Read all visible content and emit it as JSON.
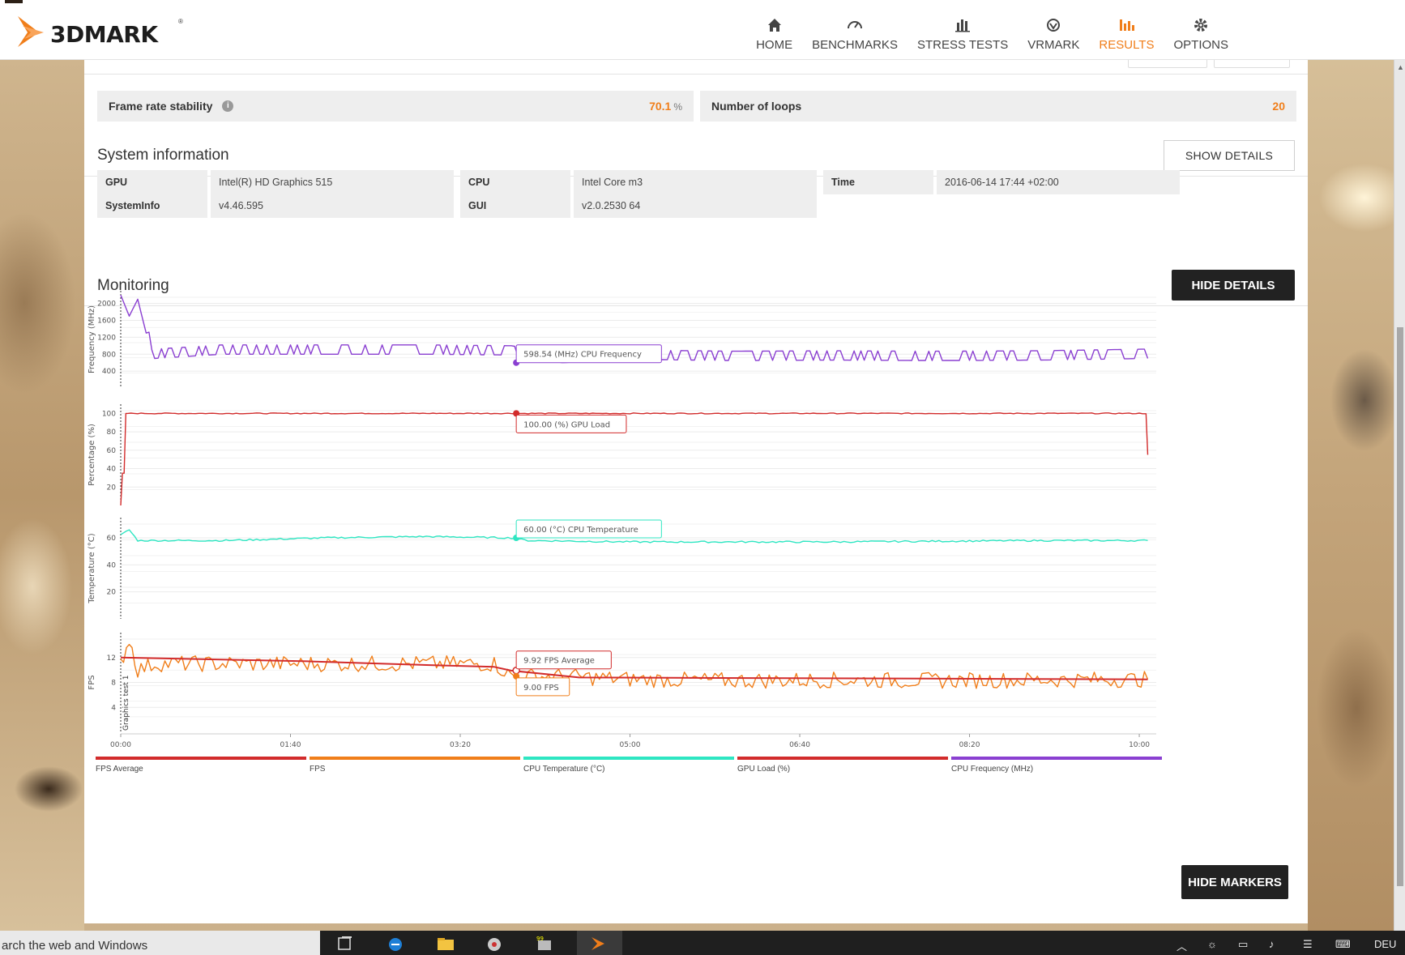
{
  "app": {
    "logo_text": "3DMARK"
  },
  "nav": {
    "items": [
      {
        "label": "HOME",
        "icon": "home-icon",
        "active": false
      },
      {
        "label": "BENCHMARKS",
        "icon": "gauge-icon",
        "active": false
      },
      {
        "label": "STRESS TESTS",
        "icon": "bars-icon",
        "active": false
      },
      {
        "label": "VRMARK",
        "icon": "vr-icon",
        "active": false
      },
      {
        "label": "RESULTS",
        "icon": "results-icon",
        "active": true
      },
      {
        "label": "OPTIONS",
        "icon": "gear-icon",
        "active": false
      }
    ],
    "accent_color": "#f07e1a"
  },
  "stats": {
    "stability_label": "Frame rate stability",
    "stability_value": "70.1",
    "stability_unit": "%",
    "loops_label": "Number of loops",
    "loops_value": "20"
  },
  "system_info": {
    "title": "System information",
    "show_details": "SHOW DETAILS",
    "rows": [
      {
        "key": "GPU",
        "value": "Intel(R) HD Graphics 515"
      },
      {
        "key": "CPU",
        "value": "Intel Core m3"
      },
      {
        "key": "Time",
        "value": "2016-06-14 17:44 +02:00"
      },
      {
        "key": "SystemInfo",
        "value": "v4.46.595"
      },
      {
        "key": "GUI",
        "value": "v2.0.2530 64"
      }
    ]
  },
  "monitoring": {
    "title": "Monitoring",
    "hide_details": "HIDE DETAILS",
    "hide_markers": "HIDE MARKERS",
    "tooltips": {
      "cpu_freq": "598.54 (MHz) CPU Frequency",
      "gpu_load": "100.00 (%) GPU Load",
      "cpu_temp": "60.00 (°C) CPU Temperature",
      "fps_avg": "9.92 FPS Average",
      "fps": "9.00 FPS"
    },
    "marker_label": "Graphics test 1",
    "legend": [
      {
        "label": "FPS Average",
        "color": "#d22b2b"
      },
      {
        "label": "FPS",
        "color": "#f07e1a"
      },
      {
        "label": "CPU Temperature (°C)",
        "color": "#2ee6c2"
      },
      {
        "label": "GPU Load (%)",
        "color": "#d22b2b"
      },
      {
        "label": "CPU Frequency (MHz)",
        "color": "#8a3fd1"
      }
    ]
  },
  "chart_data": [
    {
      "type": "line",
      "ylabel": "Frequency (MHz)",
      "yticks": [
        2000,
        1600,
        1200,
        800,
        400
      ],
      "ylim": [
        0,
        2300
      ],
      "xlim": [
        0,
        610
      ],
      "series": [
        {
          "name": "CPU Frequency (MHz)",
          "color": "#8a3fd1",
          "x": [
            0,
            5,
            10,
            15,
            20,
            60,
            120,
            180,
            230,
            260,
            300,
            360,
            420,
            480,
            540,
            605
          ],
          "y": [
            2200,
            1700,
            2100,
            1300,
            700,
            800,
            800,
            800,
            780,
            600,
            680,
            650,
            660,
            650,
            660,
            700
          ]
        }
      ]
    },
    {
      "type": "line",
      "ylabel": "Percentage (%)",
      "yticks": [
        100,
        80,
        60,
        40,
        20
      ],
      "ylim": [
        0,
        110
      ],
      "xlim": [
        0,
        610
      ],
      "series": [
        {
          "name": "GPU Load (%)",
          "color": "#d22b2b",
          "x": [
            0,
            1,
            2,
            3,
            4,
            600,
            604,
            605
          ],
          "y": [
            0,
            35,
            35,
            100,
            100,
            100,
            100,
            55
          ]
        }
      ]
    },
    {
      "type": "line",
      "ylabel": "Temperature (°C)",
      "yticks": [
        60,
        40,
        20
      ],
      "ylim": [
        0,
        75
      ],
      "xlim": [
        0,
        610
      ],
      "series": [
        {
          "name": "CPU Temperature (°C)",
          "color": "#2ee6c2",
          "x": [
            0,
            5,
            10,
            60,
            120,
            180,
            230,
            240,
            300,
            420,
            540,
            605
          ],
          "y": [
            62,
            66,
            58,
            58,
            60,
            61,
            60,
            58,
            57,
            57,
            58,
            58
          ]
        }
      ]
    },
    {
      "type": "line",
      "ylabel": "FPS",
      "yticks": [
        12,
        8,
        4
      ],
      "ylim": [
        0,
        16
      ],
      "xlim": [
        0,
        610
      ],
      "xticks": [
        "00:00",
        "01:40",
        "03:20",
        "05:00",
        "06:40",
        "08:20",
        "10:00"
      ],
      "series": [
        {
          "name": "FPS",
          "color": "#f07e1a",
          "x": [
            0,
            5,
            10,
            20,
            60,
            120,
            180,
            220,
            230,
            260,
            300,
            360,
            420,
            480,
            540,
            605
          ],
          "y": [
            11,
            15,
            10,
            11,
            11,
            11,
            11,
            11,
            9,
            9,
            8.5,
            8.3,
            8.4,
            8.3,
            8.4,
            8.5
          ]
        },
        {
          "name": "FPS Average",
          "color": "#d22b2b",
          "x": [
            0,
            110,
            180,
            220,
            230,
            270,
            605
          ],
          "y": [
            12,
            11.4,
            10.8,
            10.5,
            9.9,
            8.8,
            8.5
          ]
        }
      ]
    }
  ],
  "taskbar": {
    "search_placeholder": "arch the web and Windows",
    "lang": "DEU"
  }
}
